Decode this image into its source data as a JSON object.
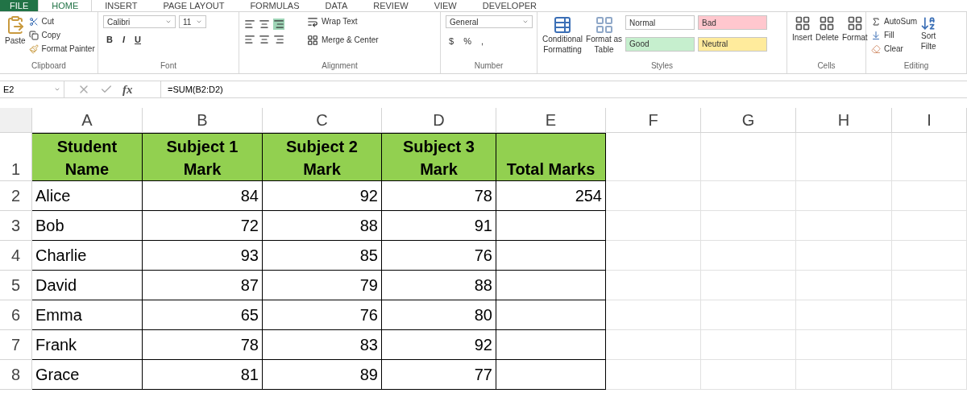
{
  "tabs": [
    {
      "label": "FILE",
      "selected": false,
      "kind": "file"
    },
    {
      "label": "HOME",
      "selected": true,
      "kind": "tab"
    },
    {
      "label": "INSERT",
      "selected": false,
      "kind": "tab"
    },
    {
      "label": "PAGE LAYOUT",
      "selected": false,
      "kind": "tab"
    },
    {
      "label": "FORMULAS",
      "selected": false,
      "kind": "tab"
    },
    {
      "label": "DATA",
      "selected": false,
      "kind": "tab"
    },
    {
      "label": "REVIEW",
      "selected": false,
      "kind": "tab"
    },
    {
      "label": "VIEW",
      "selected": false,
      "kind": "tab"
    },
    {
      "label": "DEVELOPER",
      "selected": false,
      "kind": "tab"
    }
  ],
  "clipboard": {
    "paste": "Paste",
    "cut": "Cut",
    "copy": "Copy",
    "format_painter": "Format Painter",
    "label": "Clipboard"
  },
  "font": {
    "font_name": "Calibri",
    "font_size": "11",
    "bold": "B",
    "italic": "I",
    "underline": "U",
    "label": "Font"
  },
  "alignment": {
    "wrap_text": "Wrap Text",
    "merge_center": "Merge & Center",
    "label": "Alignment"
  },
  "number": {
    "format": "General",
    "currency": "$",
    "percent": "%",
    "comma": ",",
    "label": "Number"
  },
  "styles": {
    "conditional": [
      "Conditional",
      "Formatting"
    ],
    "format_table": [
      "Format as",
      "Table"
    ],
    "cell_styles": [
      {
        "label": "Normal",
        "color": "#ffffff"
      },
      {
        "label": "Bad",
        "color": "#ffc7ce"
      },
      {
        "label": "Good",
        "color": "#c6efce"
      },
      {
        "label": "Neutral",
        "color": "#ffeb9c"
      }
    ],
    "label": "Styles"
  },
  "cells": {
    "buttons": [
      "Insert",
      "Delete",
      "Format"
    ],
    "label": "Cells"
  },
  "editing": {
    "autosum": "AutoSum",
    "fill": "Fill",
    "clear": "Clear",
    "sort": [
      "Sort",
      "Filte"
    ],
    "label": "Editing"
  },
  "formula_bar": {
    "name_box": "E2",
    "fx": "fx",
    "formula": "=SUM(B2:D2)"
  },
  "columns": [
    {
      "letter": "A",
      "kind": "text"
    },
    {
      "letter": "B",
      "kind": "number"
    },
    {
      "letter": "C",
      "kind": "number"
    },
    {
      "letter": "D",
      "kind": "number"
    },
    {
      "letter": "E",
      "kind": "number"
    },
    {
      "letter": "F"
    },
    {
      "letter": "G"
    },
    {
      "letter": "H"
    },
    {
      "letter": "I"
    }
  ],
  "rows": [
    {
      "number": "1",
      "header": true,
      "cells": [
        [
          "Student",
          "Name"
        ],
        [
          "Subject 1",
          "Mark"
        ],
        [
          "Subject 2",
          "Mark"
        ],
        [
          "Subject 3",
          "Mark"
        ],
        [
          "Total Marks"
        ]
      ]
    },
    {
      "number": "2",
      "header": false,
      "cells": [
        "Alice",
        "84",
        "92",
        "78",
        "254"
      ]
    },
    {
      "number": "3",
      "header": false,
      "cells": [
        "Bob",
        "72",
        "88",
        "91"
      ]
    },
    {
      "number": "4",
      "header": false,
      "cells": [
        "Charlie",
        "93",
        "85",
        "76"
      ]
    },
    {
      "number": "5",
      "header": false,
      "cells": [
        "David",
        "87",
        "79",
        "88"
      ]
    },
    {
      "number": "6",
      "header": false,
      "cells": [
        "Emma",
        "65",
        "76",
        "80"
      ]
    },
    {
      "number": "7",
      "header": false,
      "cells": [
        "Frank",
        "78",
        "83",
        "92"
      ]
    },
    {
      "number": "8",
      "header": false,
      "cells": [
        "Grace",
        "81",
        "89",
        "77"
      ]
    }
  ]
}
